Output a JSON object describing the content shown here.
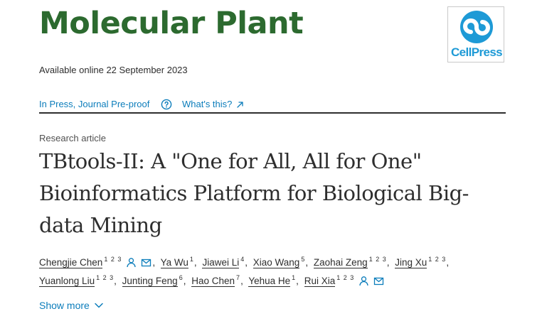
{
  "journal": {
    "title": "Molecular Plant",
    "publisher_logo_text": "CellPress"
  },
  "availability": "Available online 22 September 2023",
  "status_bar": {
    "press_link": "In Press, Journal Pre-proof",
    "help_icon": "question-circle-icon",
    "whats_this": "What's this?",
    "external_icon": "external-link-arrow-icon"
  },
  "article": {
    "type": "Research article",
    "title_lines": [
      "TBtools-II: A \"One for All, All for One\"",
      "Bioinformatics Platform for Biological Big-",
      "data Mining"
    ]
  },
  "authors": {
    "lines": [
      [
        {
          "name": "Chengjie Chen",
          "aff": "1 2 3",
          "person_icon": true,
          "mail_icon": true,
          "sep": ","
        },
        {
          "name": "Ya Wu",
          "aff": "1",
          "sep": ","
        },
        {
          "name": "Jiawei Li",
          "aff": "4",
          "sep": ","
        },
        {
          "name": "Xiao Wang",
          "aff": "5",
          "sep": ","
        },
        {
          "name": "Zaohai Zeng",
          "aff": "1 2 3",
          "sep": ","
        },
        {
          "name": "Jing Xu",
          "aff": "1 2 3",
          "sep": ","
        }
      ],
      [
        {
          "name": "Yuanlong Liu",
          "aff": "1 2 3",
          "sep": ","
        },
        {
          "name": "Junting Feng",
          "aff": "6",
          "sep": ","
        },
        {
          "name": "Hao Chen",
          "aff": "7",
          "sep": ","
        },
        {
          "name": "Yehua He",
          "aff": "1",
          "sep": ","
        },
        {
          "name": "Rui Xia",
          "aff": "1 2 3",
          "person_icon": true,
          "mail_icon": true,
          "sep": ""
        }
      ]
    ],
    "icons": {
      "person": "person-icon",
      "mail": "mail-icon"
    }
  },
  "show_more": {
    "label": "Show more",
    "icon": "chevron-down-icon"
  },
  "colors": {
    "journal_green": "#2c6a2f",
    "cellpress_blue": "#1e9ad6",
    "link_blue": "#0c7dbb",
    "text": "#2e2e2e"
  }
}
